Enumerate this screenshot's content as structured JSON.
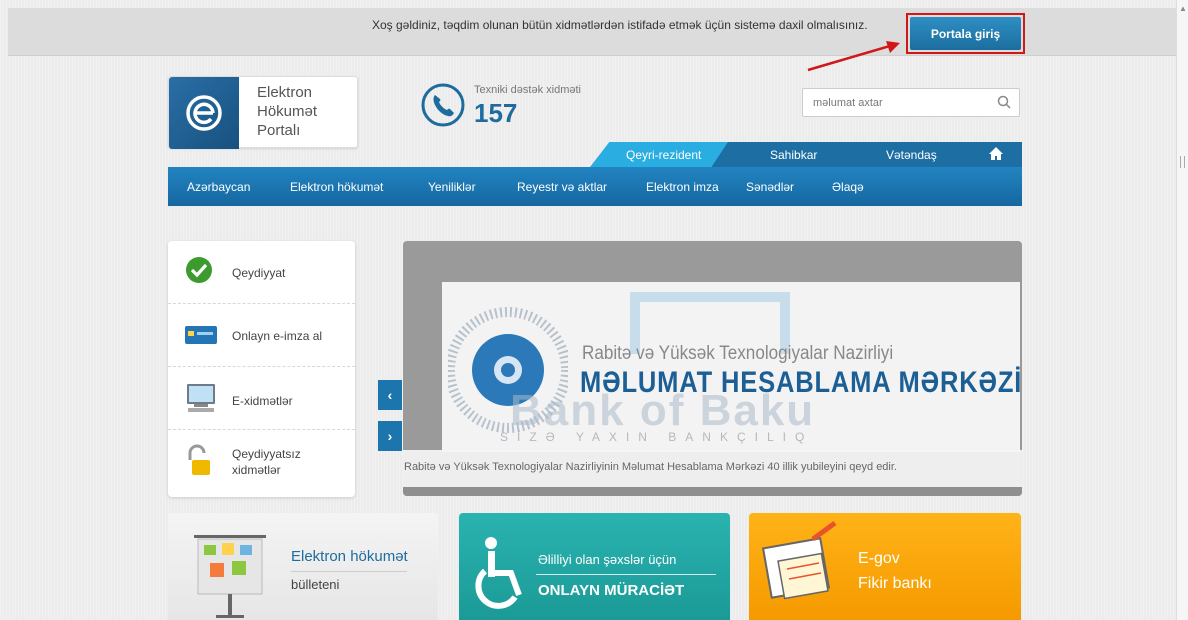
{
  "topbar": {
    "welcome_text": "Xoş gəldiniz, təqdim olunan bütün xidmətlərdən istifadə etmək üçün sistemə daxil olmalısınız.",
    "login_button": "Portala giriş"
  },
  "logo": {
    "line1": "Elektron",
    "line2": "Hökumət",
    "line3": "Portalı"
  },
  "support": {
    "label": "Texniki dəstək xidməti",
    "number": "157"
  },
  "search": {
    "placeholder": "məlumat axtar"
  },
  "audience_tabs": [
    "Qeyri-rezident",
    "Sahibkar",
    "Vətəndaş"
  ],
  "nav": [
    "Azərbaycan",
    "Elektron hökumət",
    "Yeniliklər",
    "Reyestr və aktlar",
    "Elektron imza",
    "Sənədlər",
    "Əlaqə"
  ],
  "left_panel": {
    "items": [
      {
        "label": "Qeydiyyat",
        "icon": "check-icon"
      },
      {
        "label": "Onlayn e-imza al",
        "icon": "card-icon"
      },
      {
        "label": "E-xidmətlər",
        "icon": "computer-icon"
      },
      {
        "label": "Qeydiyyatsız",
        "label2": "xidmətlər",
        "icon": "unlock-icon"
      }
    ]
  },
  "slider": {
    "ministry": "Rabitə və Yüksək Texnologiyalar Nazirliyi",
    "center_title": "MƏLUMAT HESABLAMA MƏRKƏZİ",
    "watermark": "Bank of Baku",
    "watermark_sub": "SİZƏ YAXIN BANKÇILIQ",
    "caption": "Rabitə və Yüksək Texnologiyalar Nazirliyinin Məlumat Hesablama Mərkəzi 40 illik yubileyini qeyd edir."
  },
  "cards": {
    "bulletin_title": "Elektron hökumət",
    "bulletin_sub": "bülleteni",
    "access_title": "Əlilliyi olan şəxslər üçün",
    "access_sub": "ONLAYN MÜRACİƏT",
    "egov_title": "E-gov",
    "egov_sub": "Fikir bankı"
  },
  "colors": {
    "primary_blue": "#1d6fa3",
    "accent_cyan": "#2aaee2",
    "highlight_red": "#d01818",
    "teal": "#1b9a97",
    "orange": "#f59a00"
  }
}
